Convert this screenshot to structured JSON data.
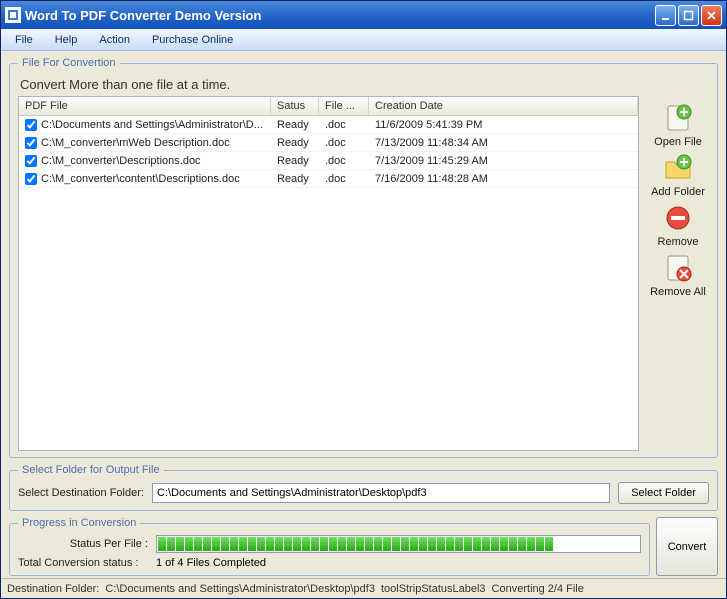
{
  "window": {
    "title": "Word To PDF Converter Demo Version"
  },
  "menu": {
    "items": [
      "File",
      "Help",
      "Action",
      "Purchase Online"
    ]
  },
  "groups": {
    "file": "File For Convertion",
    "file_subtitle": "Convert More than one file at a time.",
    "output": "Select Folder for Output File",
    "progress": "Progress in Conversion"
  },
  "table": {
    "headers": {
      "file": "PDF File",
      "status": "Satus",
      "type": "File ...",
      "created": "Creation Date"
    },
    "rows": [
      {
        "checked": true,
        "file": "C:\\Documents and Settings\\Administrator\\D...",
        "status": "Ready",
        "type": ".doc",
        "created": "11/6/2009 5:41:39 PM"
      },
      {
        "checked": true,
        "file": "C:\\M_converter\\mWeb Description.doc",
        "status": "Ready",
        "type": ".doc",
        "created": "7/13/2009 11:48:34 AM"
      },
      {
        "checked": true,
        "file": "C:\\M_converter\\Descriptions.doc",
        "status": "Ready",
        "type": ".doc",
        "created": "7/13/2009 11:45:29 AM"
      },
      {
        "checked": true,
        "file": "C:\\M_converter\\content\\Descriptions.doc",
        "status": "Ready",
        "type": ".doc",
        "created": "7/16/2009 11:48:28 AM"
      }
    ]
  },
  "actions": {
    "open_file": "Open File",
    "add_folder": "Add Folder",
    "remove": "Remove",
    "remove_all": "Remove All"
  },
  "output": {
    "label": "Select Destination Folder:",
    "value": "C:\\Documents and Settings\\Administrator\\Desktop\\pdf3",
    "button": "Select Folder"
  },
  "progress": {
    "status_label": "Status Per File :",
    "total_label": "Total Conversion status :",
    "total_value": "1 of 4 Files Completed",
    "percent": 84
  },
  "convert": {
    "label": "Convert"
  },
  "statusbar": {
    "dest_label": "Destination Folder:",
    "dest_value": "C:\\Documents and Settings\\Administrator\\Desktop\\pdf3",
    "strip": "toolStripStatusLabel3",
    "converting": "Converting 2/4 File"
  }
}
